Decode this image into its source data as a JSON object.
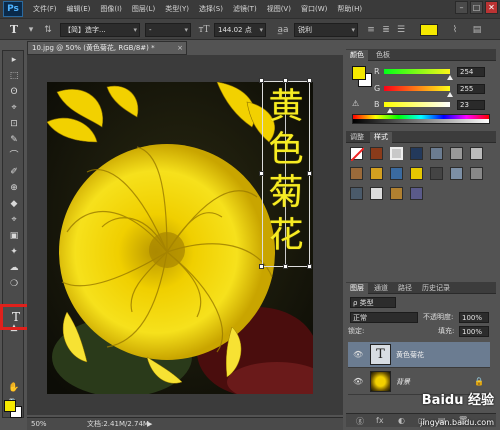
{
  "app": {
    "logo": "Ps"
  },
  "menu": [
    "文件(F)",
    "编辑(E)",
    "图像(I)",
    "图层(L)",
    "类型(Y)",
    "选择(S)",
    "滤镜(T)",
    "视图(V)",
    "窗口(W)",
    "帮助(H)"
  ],
  "window_controls": {
    "minimize": "–",
    "maximize": "□",
    "close": "✕"
  },
  "options_bar": {
    "tool_icon": "T",
    "font_family": "【简】造字...",
    "font_style": "-",
    "font_size": "144.02 点",
    "antialias": "锐利",
    "text_color": "#f5e800"
  },
  "document": {
    "tab_title": "10.jpg @ 50% (黄色菊花, RGB/8#) *",
    "close": "×",
    "vertical_text": [
      "黄",
      "色",
      "菊",
      "花"
    ]
  },
  "status": {
    "zoom": "50%",
    "doc_size": "文档:2.41M/2.74M"
  },
  "tools": {
    "active_tool": "T",
    "items": [
      "▸",
      "⬚",
      "ʘ",
      "⌖",
      "⊡",
      "✎",
      "⌒",
      "✐",
      "⊕",
      "◆",
      "⌖",
      "▣",
      "✦",
      "☁",
      "❍",
      "▲",
      "✋",
      "🔍"
    ]
  },
  "colors": {
    "foreground": "#f5e800",
    "background": "#ffffff"
  },
  "color_panel": {
    "tabs": [
      "颜色",
      "色板"
    ],
    "r_label": "R",
    "g_label": "G",
    "b_label": "B",
    "r": "254",
    "g": "255",
    "b": "23",
    "r_level": 0.996,
    "g_level": 1.0,
    "b_level": 0.09
  },
  "adjustments_panel": {
    "tabs": [
      "调整",
      "样式"
    ]
  },
  "layers_panel": {
    "tabs": [
      "图层",
      "通道",
      "路径",
      "历史记录"
    ],
    "kind_label": "ρ 类型",
    "blend_mode": "正常",
    "opacity_label": "不透明度:",
    "opacity": "100%",
    "lock_label": "锁定:",
    "fill_label": "填充:",
    "fill": "100%",
    "layers": [
      {
        "name": "黄色菊花",
        "thumb": "T",
        "type": "text"
      },
      {
        "name": "背景",
        "thumb": "",
        "type": "image"
      }
    ],
    "footer_icons": [
      "ⓖ",
      "fx",
      "◐",
      "▢",
      "▤",
      "🗑"
    ]
  },
  "watermark": {
    "brand": "Baidu 经验",
    "url": "jingyan.baidu.com"
  }
}
